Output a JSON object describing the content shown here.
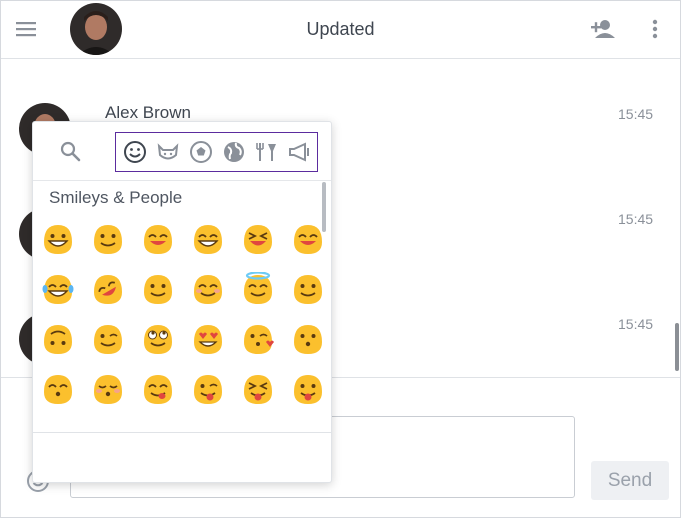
{
  "header": {
    "title": "Updated",
    "menu_icon": "hamburger-menu-icon",
    "add_user_icon": "add-user-icon",
    "more_icon": "more-vertical-icon"
  },
  "messages": [
    {
      "author": "Alex Brown",
      "time": "15:45"
    },
    {
      "author": "",
      "time": "15:45"
    },
    {
      "author": "",
      "time": "15:45"
    }
  ],
  "picker": {
    "search_icon": "search-icon",
    "categories": [
      "smileys-category-icon",
      "animals-category-icon",
      "activity-category-icon",
      "travel-category-icon",
      "food-category-icon",
      "objects-category-icon"
    ],
    "section_title": "Smileys & People"
  },
  "composer": {
    "send_label": "Send",
    "emoji_toggle_icon": "smiley-icon"
  },
  "colors": {
    "accent": "#5b2c9e",
    "emoji_yellow": "#fbc02d",
    "text": "#3f4650",
    "muted": "#8a9099"
  }
}
